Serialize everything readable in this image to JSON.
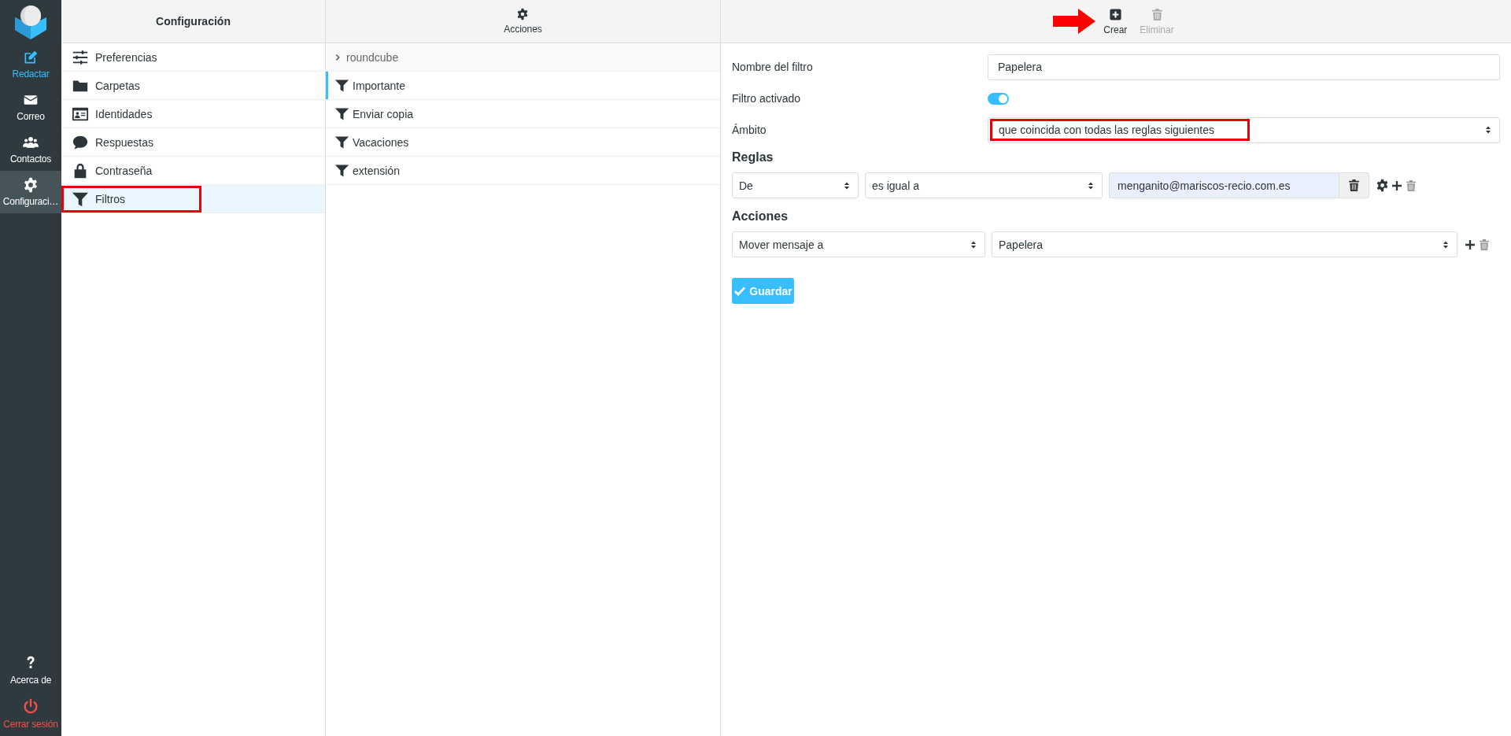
{
  "sidebar": {
    "nav": [
      {
        "label": "Redactar",
        "kind": "compose",
        "selected": false
      },
      {
        "label": "Correo",
        "kind": "mail",
        "selected": false
      },
      {
        "label": "Contactos",
        "kind": "contacts",
        "selected": false
      },
      {
        "label": "Configuraci…",
        "kind": "settings",
        "selected": true
      }
    ],
    "footer": [
      {
        "label": "Acerca de",
        "kind": "about"
      },
      {
        "label": "Cerrar sesión",
        "kind": "logout"
      }
    ]
  },
  "settings_panel": {
    "title": "Configuración",
    "items": [
      {
        "label": "Preferencias",
        "kind": "preferences",
        "selected": false,
        "highlighted": false
      },
      {
        "label": "Carpetas",
        "kind": "folders",
        "selected": false,
        "highlighted": false
      },
      {
        "label": "Identidades",
        "kind": "identities",
        "selected": false,
        "highlighted": false
      },
      {
        "label": "Respuestas",
        "kind": "responses",
        "selected": false,
        "highlighted": false
      },
      {
        "label": "Contraseña",
        "kind": "password",
        "selected": false,
        "highlighted": false
      },
      {
        "label": "Filtros",
        "kind": "filters",
        "selected": true,
        "highlighted": true
      }
    ]
  },
  "filters_panel": {
    "actions_button": "Acciones",
    "filter_set": "roundcube",
    "filters": [
      {
        "label": "Importante",
        "focused": true
      },
      {
        "label": "Enviar copia",
        "focused": false
      },
      {
        "label": "Vacaciones",
        "focused": false
      },
      {
        "label": "extensión",
        "focused": false
      }
    ]
  },
  "toolbar": [
    {
      "label": "Crear",
      "kind": "create",
      "disabled": false,
      "pointed": true
    },
    {
      "label": "Eliminar",
      "kind": "delete",
      "disabled": true,
      "pointed": false
    }
  ],
  "form": {
    "name": {
      "label": "Nombre del filtro",
      "value": "Papelera"
    },
    "enabled": {
      "label": "Filtro activado",
      "on": true
    },
    "scope": {
      "label": "Ámbito",
      "value": "que coincida con todas las reglas siguientes",
      "highlighted": true
    },
    "rules_heading": "Reglas",
    "rules": [
      {
        "header": "De",
        "operator": "es igual a",
        "value": "menganito@mariscos-recio.com.es"
      }
    ],
    "actions_heading": "Acciones",
    "actions": [
      {
        "type": "Mover mensaje a",
        "target": "Papelera"
      }
    ],
    "save_button": "Guardar"
  }
}
